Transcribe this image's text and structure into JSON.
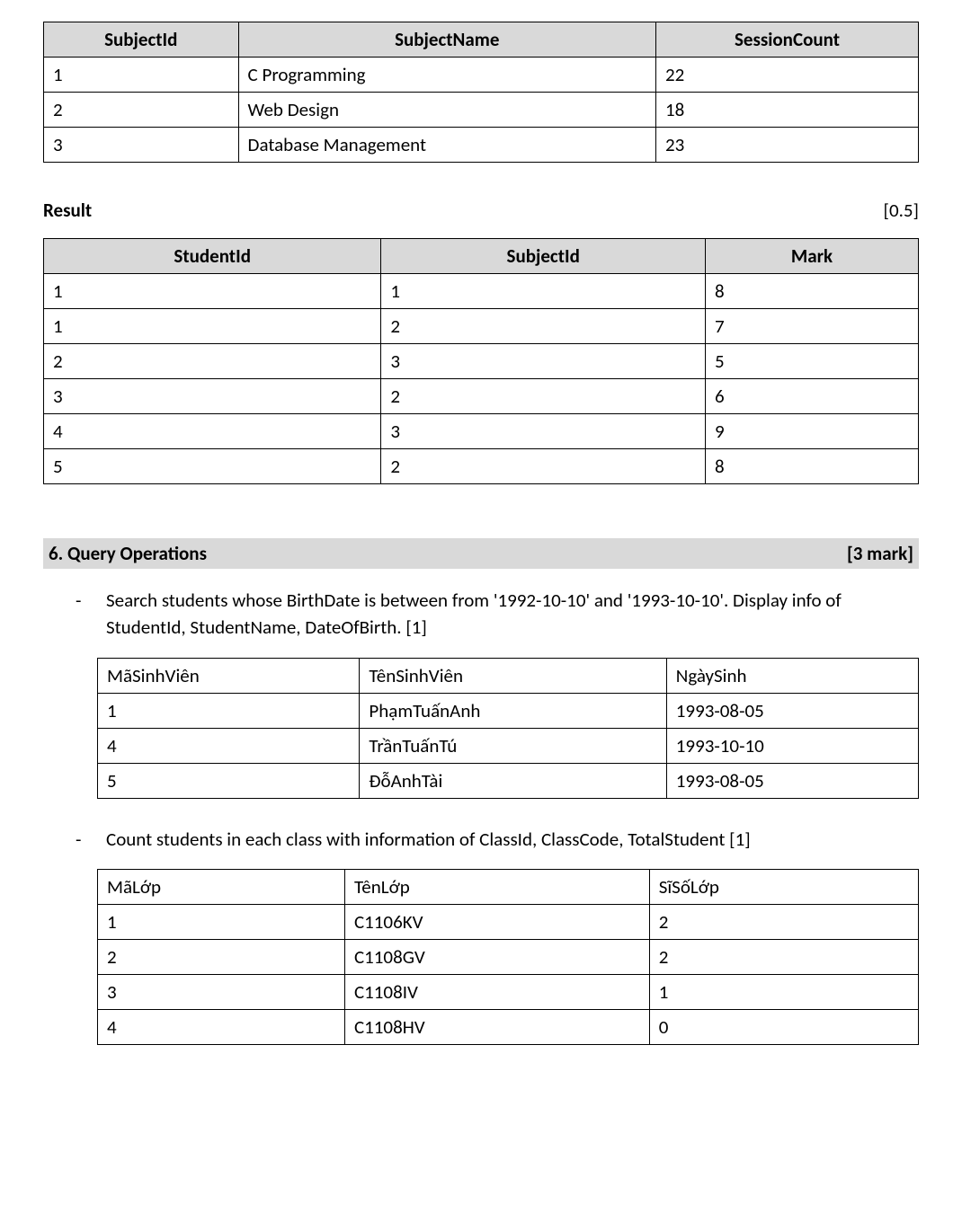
{
  "subject_table": {
    "headers": [
      "SubjectId",
      "SubjectName",
      "SessionCount"
    ],
    "rows": [
      [
        "1",
        "C Programming",
        "22"
      ],
      [
        "2",
        "Web Design",
        "18"
      ],
      [
        "3",
        "Database Management",
        "23"
      ]
    ]
  },
  "result_label": "Result",
  "result_score": "[0.5]",
  "result_table": {
    "headers": [
      "StudentId",
      "SubjectId",
      "Mark"
    ],
    "rows": [
      [
        "1",
        "1",
        "8"
      ],
      [
        "1",
        "2",
        "7"
      ],
      [
        "2",
        "3",
        "5"
      ],
      [
        "3",
        "2",
        "6"
      ],
      [
        "4",
        "3",
        "9"
      ],
      [
        "5",
        "2",
        "8"
      ]
    ]
  },
  "section6_title": "6. Query Operations",
  "section6_score": "[3 mark]",
  "query1_text": "Search students whose BirthDate is between  from '1992-10-10' and  '1993-10-10'. Display info of StudentId, StudentName, DateOfBirth.  [1]",
  "query1_table": {
    "headers": [
      "MãSinhViên",
      "TênSinhViên",
      "NgàySinh"
    ],
    "rows": [
      [
        "1",
        "PhạmTuấnAnh",
        "1993-08-05"
      ],
      [
        "4",
        "TrầnTuấnTú",
        "1993-10-10"
      ],
      [
        "5",
        "ĐỗAnhTài",
        "1993-08-05"
      ]
    ]
  },
  "query2_text": "Count students in each class with information of ClassId, ClassCode, TotalStudent [1]",
  "query2_table": {
    "headers": [
      "MãLớp",
      "TênLớp",
      "SĩSốLớp"
    ],
    "rows": [
      [
        "1",
        "C1106KV",
        "2"
      ],
      [
        "2",
        "C1108GV",
        "2"
      ],
      [
        "3",
        "C1108IV",
        "1"
      ],
      [
        "4",
        "C1108HV",
        "0"
      ]
    ]
  }
}
